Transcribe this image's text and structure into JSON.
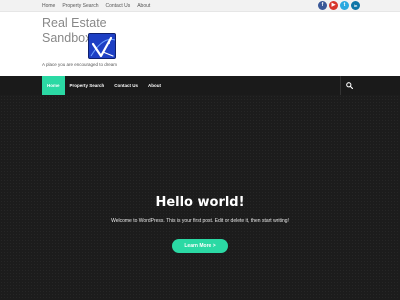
{
  "topnav": {
    "items": [
      "Home",
      "Property Search",
      "Contact Us",
      "About"
    ]
  },
  "socials": [
    {
      "name": "facebook-icon",
      "glyph": "f",
      "color": "#3b5998"
    },
    {
      "name": "youtube-icon",
      "glyph": "▶",
      "color": "#d8352a"
    },
    {
      "name": "twitter-icon",
      "glyph": "t",
      "color": "#2aa9e0"
    },
    {
      "name": "linkedin-icon",
      "glyph": "in",
      "color": "#0e76a8"
    }
  ],
  "brand": {
    "title_line1": "Real Estate",
    "title_line2": "Sandbox",
    "tagline": "A place you are encouraged to dream"
  },
  "mainnav": {
    "items": [
      "Home",
      "Property Search",
      "Contact Us",
      "About"
    ],
    "active_index": 0
  },
  "hero": {
    "title": "Hello world!",
    "text": "Welcome to WordPress. This is your first post. Edit or delete it, then start writing!",
    "button_label": "Learn More >"
  },
  "colors": {
    "accent": "#2bd9a4",
    "nav_bg": "#1a1a1a",
    "hero_bg": "#1c1c1c"
  }
}
